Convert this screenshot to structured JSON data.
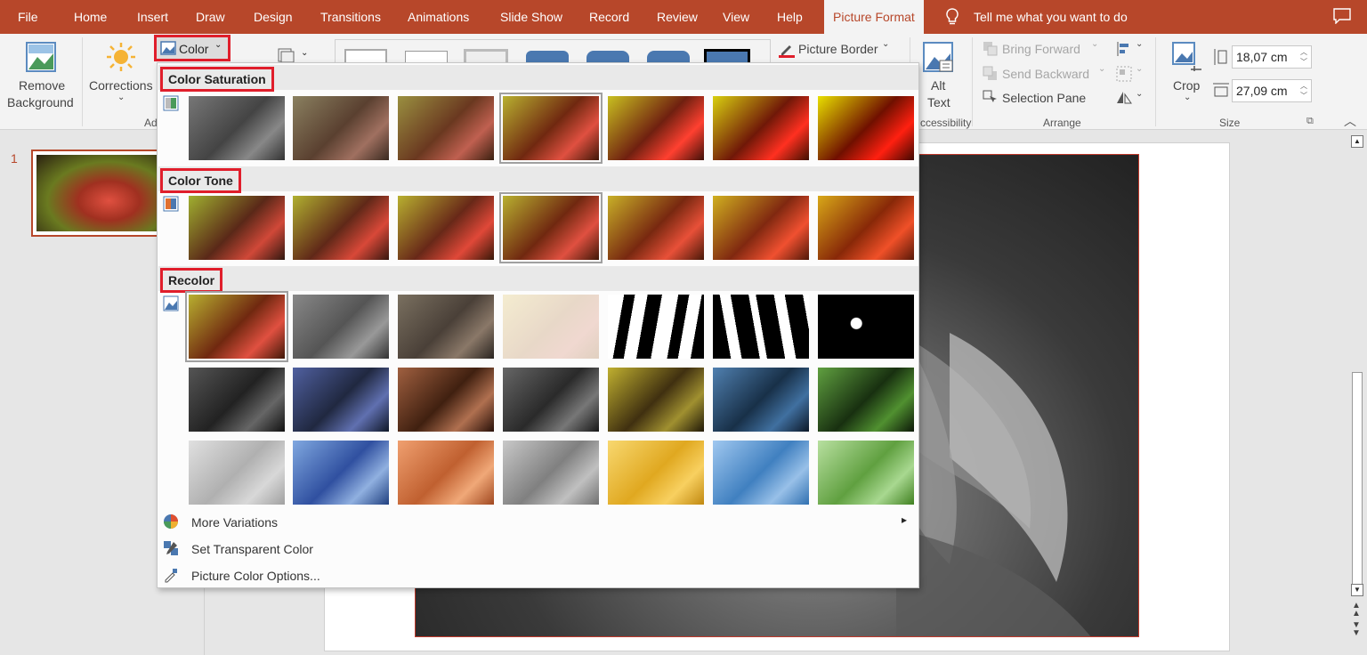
{
  "tabs": [
    "File",
    "Home",
    "Insert",
    "Draw",
    "Design",
    "Transitions",
    "Animations",
    "Slide Show",
    "Record",
    "Review",
    "View",
    "Help",
    "Picture Format"
  ],
  "tell_me": "Tell me what you want to do",
  "ribbon": {
    "remove_background": [
      "Remove",
      "Background"
    ],
    "corrections": "Corrections",
    "color": "Color",
    "adjust_group_partial": "Ad",
    "picture_border": "Picture Border",
    "alt_text": [
      "Alt",
      "Text"
    ],
    "accessibility_partial": "ccessibility",
    "bring_forward": "Bring Forward",
    "send_backward": "Send Backward",
    "selection_pane": "Selection Pane",
    "arrange_label": "Arrange",
    "crop": "Crop",
    "height_value": "18,07 cm",
    "width_value": "27,09 cm",
    "size_label": "Size"
  },
  "thumbnail": {
    "slide_number": "1"
  },
  "color_menu": {
    "saturation_title": "Color Saturation",
    "tone_title": "Color Tone",
    "recolor_title": "Recolor",
    "more_variations": "More Variations",
    "set_transparent": "Set Transparent Color",
    "picture_color_options": "Picture Color Options..."
  },
  "colors": {
    "accent": "#b7472a",
    "highlight_box": "#e01e2b"
  },
  "swatches": {
    "saturation": [
      "linear-gradient(135deg,#777,#444 50%,#888 75%,#333)",
      "linear-gradient(135deg,#8a8060,#5a4030 50%,#a07060 75%,#3a2a20)",
      "linear-gradient(135deg,#9a9040,#6a3820 50%,#c06050 75%,#3a2010)",
      "linear-gradient(135deg,#b8b030,#702810 50%,#e05040 75%,#401808)",
      "linear-gradient(135deg,#c8c020,#702010 50%,#ff4030 75%,#401008)",
      "linear-gradient(135deg,#d8d010,#701808 50%,#ff3020 75%,#401000)",
      "linear-gradient(135deg,#e8e000,#701000 50%,#ff2010 75%,#400800)"
    ],
    "tone": [
      "linear-gradient(135deg,#a0b030,#5a2818 50%,#d04838 75%,#301810)",
      "linear-gradient(135deg,#b0b030,#602818 50%,#d84838 75%,#381810)",
      "linear-gradient(135deg,#b8b030,#682818 50%,#e04838 75%,#381808)",
      "linear-gradient(135deg,#b8b030,#702810 50%,#e05040 75%,#401808)",
      "linear-gradient(135deg,#c8b028,#782810 50%,#e85038 75%,#481808)",
      "linear-gradient(135deg,#d0b020,#802810 50%,#f05030 75%,#501808)",
      "linear-gradient(135deg,#d8a818,#882808 50%,#f05028 75%,#581808)"
    ],
    "recolor": [
      "linear-gradient(135deg,#b8b030,#702810 50%,#e05040 75%,#401808)",
      "linear-gradient(135deg,#888,#555 50%,#999 75%,#333)",
      "linear-gradient(135deg,#7a7060,#4a4038 50%,#8a7868 75%,#2a2420)",
      "linear-gradient(135deg,#f4ecd0,#e8d8c8 50%,#f0d8d0 75%,#e0d0c0)",
      "repeating-linear-gradient(100deg,#fff 0 18px,#000 18px 30px,#fff 30px 44px,#000 44px 60px)",
      "repeating-linear-gradient(80deg,#000 0 20px,#fff 20px 32px,#000 32px 52px,#fff 52px 60px)",
      "radial-gradient(circle at 40% 45%,#fff 0 6px,#000 7px)",
      "linear-gradient(135deg,#555,#222 50%,#666 75%,#111)",
      "linear-gradient(135deg,#5060a0,#202840 50%,#6070b0 75%,#101828)",
      "linear-gradient(135deg,#a06040,#402010 50%,#b07050 75%,#281008)",
      "linear-gradient(135deg,#666,#2a2a2a 50%,#777 75%,#181818)",
      "linear-gradient(135deg,#c0b030,#403010 50%,#a09030 75%,#201808)",
      "linear-gradient(135deg,#5080b0,#183048 50%,#4070a0 75%,#0c1828)",
      "linear-gradient(135deg,#60a040,#183010 50%,#509030 75%,#0c1808)",
      "linear-gradient(135deg,#e0e0e0,#b0b0b0 50%,#d8d8d8 75%,#a0a0a0)",
      "linear-gradient(135deg,#80a8e0,#3050a0 50%,#90b0e0 75%,#204080)",
      "linear-gradient(135deg,#f0a070,#c06030 50%,#f0a878 75%,#a04820)",
      "linear-gradient(135deg,#c8c8c8,#808080 50%,#c0c0c0 75%,#707070)",
      "linear-gradient(135deg,#f8d870,#e0a820 50%,#f8d060 75%,#c08810)",
      "linear-gradient(135deg,#a0c8f0,#4080c0 50%,#98c0e8 75%,#3070b0)",
      "linear-gradient(135deg,#b8e0a0,#60a040 50%,#a8d890 75%,#408020)"
    ]
  }
}
